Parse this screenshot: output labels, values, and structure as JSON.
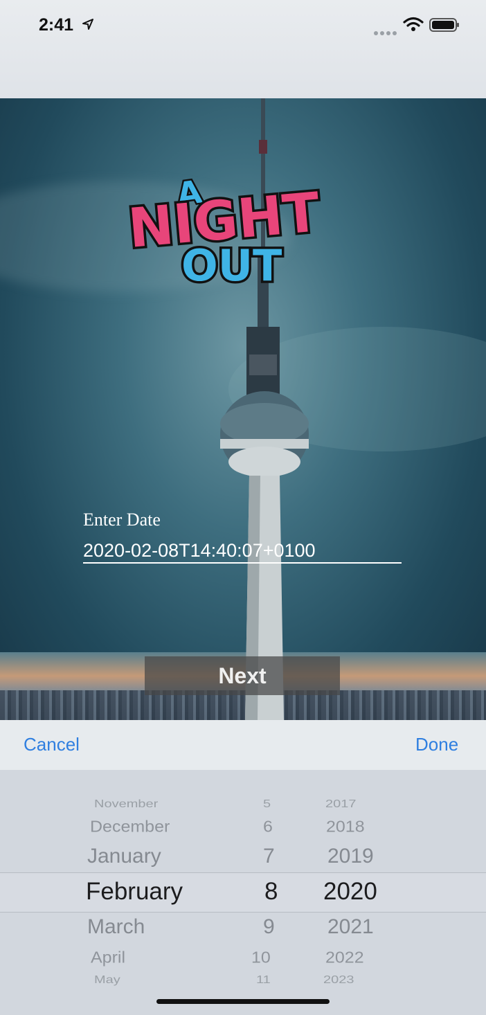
{
  "status_bar": {
    "time": "2:41"
  },
  "logo": {
    "line1": "A",
    "line2": "NIGHT",
    "line3": "OUT"
  },
  "form": {
    "date_label": "Enter Date",
    "date_value": "2020-02-08T14:40:07+0100",
    "next_label": "Next"
  },
  "toolbar": {
    "cancel_label": "Cancel",
    "done_label": "Done"
  },
  "picker": {
    "months": [
      "November",
      "December",
      "January",
      "February",
      "March",
      "April",
      "May"
    ],
    "days": [
      "5",
      "6",
      "7",
      "8",
      "9",
      "10",
      "11"
    ],
    "years": [
      "2017",
      "2018",
      "2019",
      "2020",
      "2021",
      "2022",
      "2023"
    ],
    "selected": {
      "month": "February",
      "day": "8",
      "year": "2020"
    }
  },
  "colors": {
    "accent": "#2f7fe0",
    "logo_pink": "#e8457a",
    "logo_blue": "#3fb4e6"
  }
}
